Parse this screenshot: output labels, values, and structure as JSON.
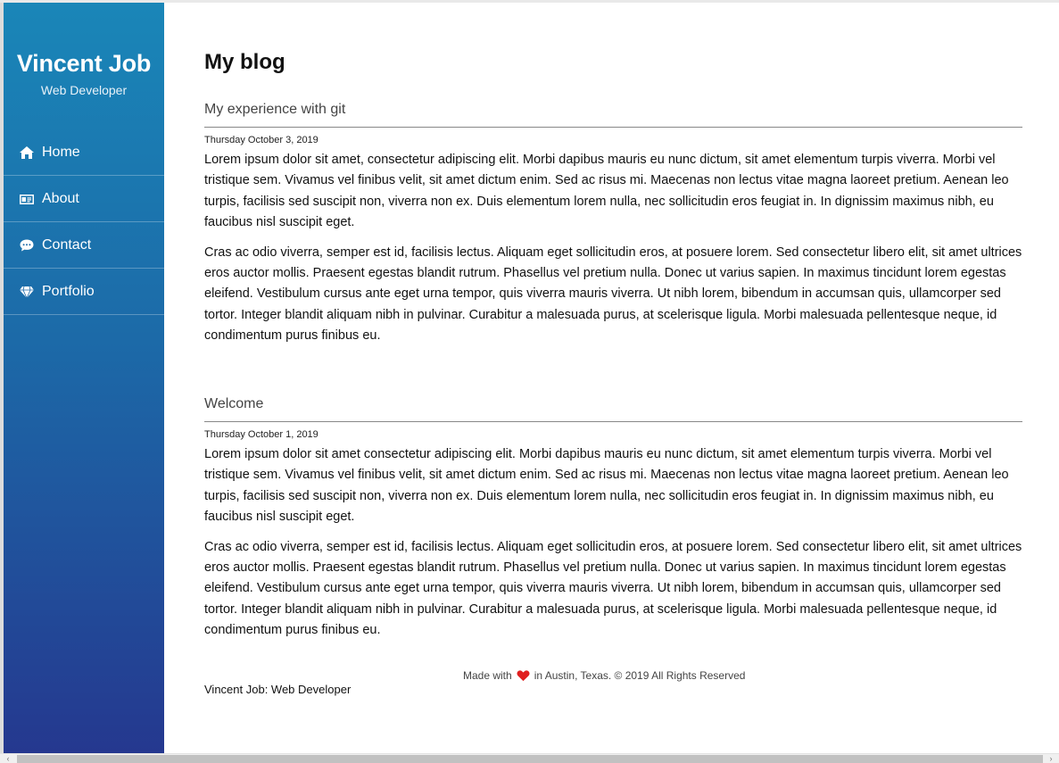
{
  "sidebar": {
    "name": "Vincent Job",
    "role": "Web Developer",
    "items": [
      {
        "label": "Home",
        "icon": "home-icon"
      },
      {
        "label": "About",
        "icon": "id-card-icon"
      },
      {
        "label": "Contact",
        "icon": "chat-icon"
      },
      {
        "label": "Portfolio",
        "icon": "gem-icon"
      }
    ]
  },
  "main": {
    "title": "My blog",
    "posts": [
      {
        "title": "My experience with git",
        "date": "Thursday October 3, 2019",
        "paragraphs": [
          "Lorem ipsum dolor sit amet, consectetur adipiscing elit. Morbi dapibus mauris eu nunc dictum, sit amet elementum turpis viverra. Morbi vel tristique sem. Vivamus vel finibus velit, sit amet dictum enim. Sed ac risus mi. Maecenas non lectus vitae magna laoreet pretium. Aenean leo turpis, facilisis sed suscipit non, viverra non ex. Duis elementum lorem nulla, nec sollicitudin eros feugiat in. In dignissim maximus nibh, eu faucibus nisl suscipit eget.",
          "Cras ac odio viverra, semper est id, facilisis lectus. Aliquam eget sollicitudin eros, at posuere lorem. Sed consectetur libero elit, sit amet ultrices eros auctor mollis. Praesent egestas blandit rutrum. Phasellus vel pretium nulla. Donec ut varius sapien. In maximus tincidunt lorem egestas eleifend. Vestibulum cursus ante eget urna tempor, quis viverra mauris viverra. Ut nibh lorem, bibendum in accumsan quis, ullamcorper sed tortor. Integer blandit aliquam nibh in pulvinar. Curabitur a malesuada purus, at scelerisque ligula. Morbi malesuada pellentesque neque, id condimentum purus finibus eu."
        ]
      },
      {
        "title": "Welcome",
        "date": "Thursday October 1, 2019",
        "paragraphs": [
          "Lorem ipsum dolor sit amet consectetur adipiscing elit. Morbi dapibus mauris eu nunc dictum, sit amet elementum turpis viverra. Morbi vel tristique sem. Vivamus vel finibus velit, sit amet dictum enim. Sed ac risus mi. Maecenas non lectus vitae magna laoreet pretium. Aenean leo turpis, facilisis sed suscipit non, viverra non ex. Duis elementum lorem nulla, nec sollicitudin eros feugiat in. In dignissim maximus nibh, eu faucibus nisl suscipit eget.",
          "Cras ac odio viverra, semper est id, facilisis lectus. Aliquam eget sollicitudin eros, at posuere lorem. Sed consectetur libero elit, sit amet ultrices eros auctor mollis. Praesent egestas blandit rutrum. Phasellus vel pretium nulla. Donec ut varius sapien. In maximus tincidunt lorem egestas eleifend. Vestibulum cursus ante eget urna tempor, quis viverra mauris viverra. Ut nibh lorem, bibendum in accumsan quis, ullamcorper sed tortor. Integer blandit aliquam nibh in pulvinar. Curabitur a malesuada purus, at scelerisque ligula. Morbi malesuada pellentesque neque, id condimentum purus finibus eu."
        ]
      }
    ]
  },
  "footer": {
    "made_with": "Made with",
    "heart_icon": "heart-icon",
    "location": "in Austin, Texas. © 2019 All Rights Reserved",
    "name_line": "Vincent Job: Web Developer"
  },
  "colors": {
    "sidebar_top": "#1a86b8",
    "sidebar_bottom": "#25388f",
    "heart": "#e02020"
  },
  "scrollbar": {
    "left_arrow": "‹",
    "right_arrow": "›"
  }
}
